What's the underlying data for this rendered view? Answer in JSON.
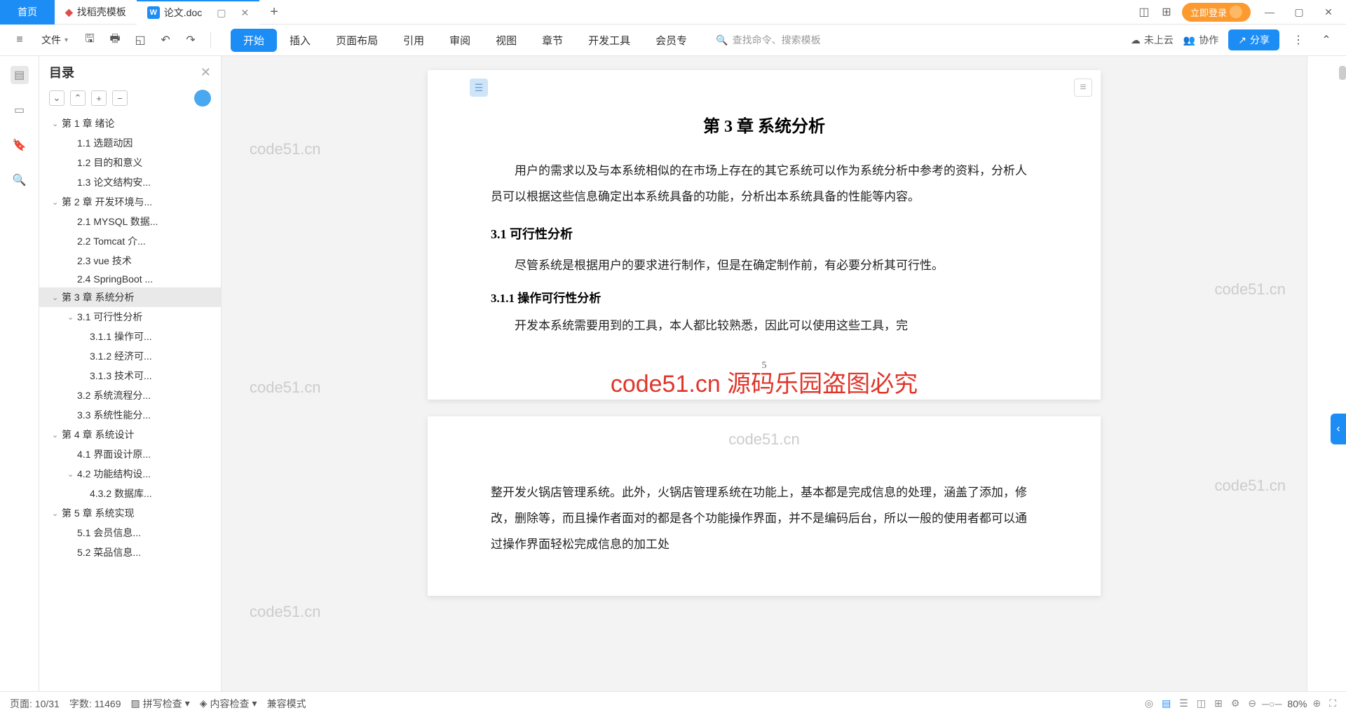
{
  "tabs": {
    "home": "首页",
    "template": "找稻壳模板",
    "doc_name": "论文.doc",
    "doc_badge": "W"
  },
  "login_label": "立即登录",
  "file_menu": "文件",
  "ribbon": [
    "开始",
    "插入",
    "页面布局",
    "引用",
    "审阅",
    "视图",
    "章节",
    "开发工具",
    "会员专"
  ],
  "search_placeholder": "查找命令、搜索模板",
  "cloud_status": "未上云",
  "collab": "协作",
  "share": "分享",
  "outline": {
    "title": "目录",
    "items": [
      {
        "lvl": 1,
        "chev": "⌄",
        "label": "第 1 章  绪论"
      },
      {
        "lvl": 2,
        "label": "1.1 选题动因"
      },
      {
        "lvl": 2,
        "label": "1.2 目的和意义"
      },
      {
        "lvl": 2,
        "label": "1.3 论文结构安..."
      },
      {
        "lvl": 1,
        "chev": "⌄",
        "label": "第 2 章  开发环境与..."
      },
      {
        "lvl": 2,
        "label": "2.1 MYSQL 数据..."
      },
      {
        "lvl": 2,
        "label": "2.2 Tomcat  介..."
      },
      {
        "lvl": 2,
        "label": "2.3 vue 技术"
      },
      {
        "lvl": 2,
        "label": "2.4 SpringBoot ..."
      },
      {
        "lvl": 1,
        "chev": "⌄",
        "label": "第 3 章  系统分析",
        "sel": true
      },
      {
        "lvl": 2,
        "chev": "⌄",
        "label": "3.1 可行性分析"
      },
      {
        "lvl": 3,
        "label": "3.1.1 操作可..."
      },
      {
        "lvl": 3,
        "label": "3.1.2 经济可..."
      },
      {
        "lvl": 3,
        "label": "3.1.3 技术可..."
      },
      {
        "lvl": 2,
        "label": "3.2 系统流程分..."
      },
      {
        "lvl": 2,
        "label": "3.3 系统性能分..."
      },
      {
        "lvl": 1,
        "chev": "⌄",
        "label": "第 4 章  系统设计"
      },
      {
        "lvl": 2,
        "label": "4.1 界面设计原..."
      },
      {
        "lvl": 2,
        "chev": "⌄",
        "label": "4.2 功能结构设..."
      },
      {
        "lvl": 3,
        "label": "4.3.2  数据库..."
      },
      {
        "lvl": 1,
        "chev": "⌄",
        "label": "第 5 章  系统实现"
      },
      {
        "lvl": 2,
        "label": "5.1 会员信息..."
      },
      {
        "lvl": 2,
        "label": "5.2 菜品信息..."
      }
    ]
  },
  "doc": {
    "chapter_title": "第 3 章  系统分析",
    "p1": "用户的需求以及与本系统相似的在市场上存在的其它系统可以作为系统分析中参考的资料，分析人员可以根据这些信息确定出本系统具备的功能，分析出本系统具备的性能等内容。",
    "h31": "3.1 可行性分析",
    "p2": "尽管系统是根据用户的要求进行制作，但是在确定制作前，有必要分析其可行性。",
    "h311": "3.1.1  操作可行性分析",
    "p3": "开发本系统需要用到的工具，本人都比较熟悉，因此可以使用这些工具，完",
    "page_num": "5",
    "p4": "整开发火锅店管理系统。此外，火锅店管理系统在功能上，基本都是完成信息的处理，涵盖了添加，修改，删除等，而且操作者面对的都是各个功能操作界面，并不是编码后台，所以一般的使用者都可以通过操作界面轻松完成信息的加工处"
  },
  "watermarks": {
    "red": "code51.cn  源码乐园盗图必究",
    "grey": "code51.cn"
  },
  "status": {
    "page": "页面: 10/31",
    "words": "字数: 11469",
    "spell": "拼写检查",
    "content": "内容检查",
    "compat": "兼容模式",
    "zoom": "80%"
  }
}
